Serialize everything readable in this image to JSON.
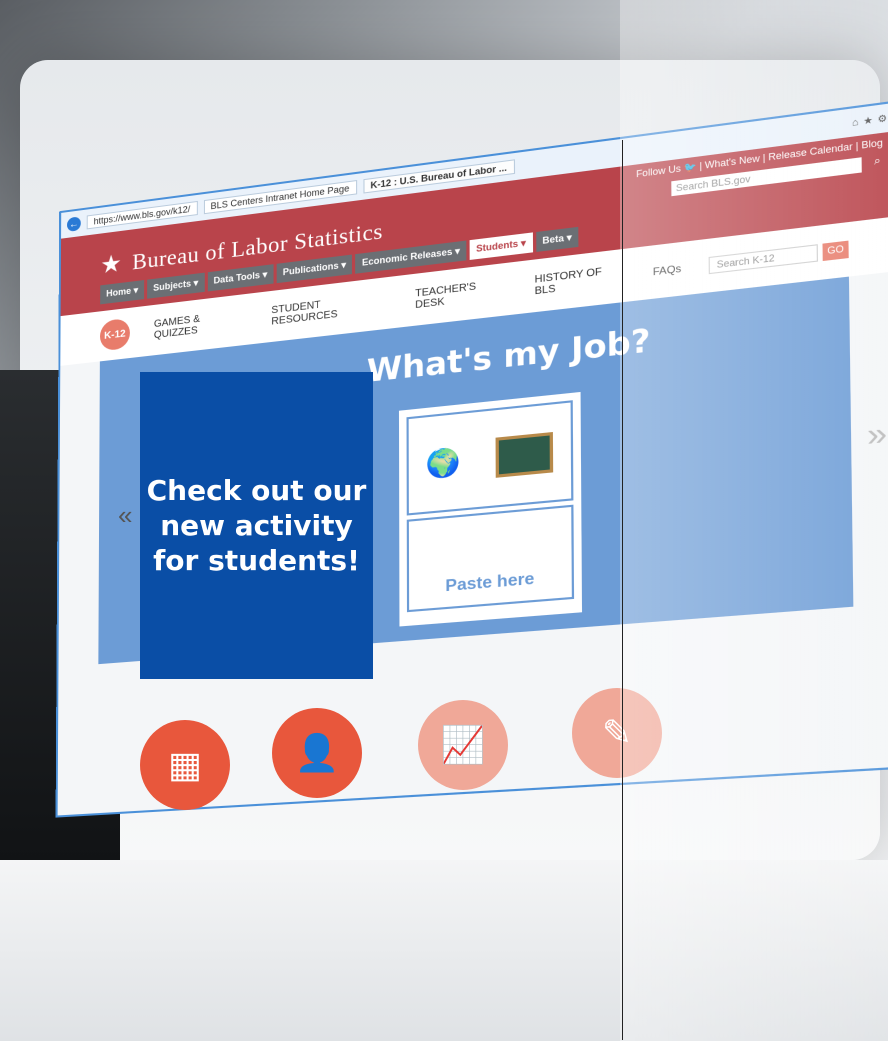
{
  "browser": {
    "url": "https://www.bls.gov/k12/",
    "tabs": [
      "BLS Centers Intranet Home Page",
      "K-12 : U.S. Bureau of Labor ..."
    ],
    "back_arrow": "←"
  },
  "header": {
    "follow_us": "Follow Us",
    "links": "| What's New | Release Calendar | Blog",
    "search_placeholder": "Search BLS.gov",
    "logo_text": "Bureau of Labor Statistics",
    "nav": [
      "Home ▾",
      "Subjects ▾",
      "Data Tools ▾",
      "Publications ▾",
      "Economic Releases ▾",
      "Students ▾",
      "Beta ▾"
    ]
  },
  "k12nav": {
    "badge": "K-12",
    "items": [
      "GAMES & QUIZZES",
      "STUDENT RESOURCES",
      "TEACHER'S DESK",
      "HISTORY OF BLS",
      "FAQs"
    ],
    "search_placeholder": "Search K-12",
    "go": "GO"
  },
  "hero": {
    "title": "What's my Job?",
    "paste_here": "Paste here",
    "next_arrow": "»",
    "prev_arrow": "«"
  },
  "callout": {
    "text": "Check out our new activity for students!"
  },
  "colors": {
    "header_red": "#b9444b",
    "callout_blue": "#0a4ea6",
    "hero_blue": "#6c9cd6",
    "icon_orange": "#e8573c"
  },
  "icons": [
    "crossword-icon",
    "reader-icon",
    "teacher-icon",
    "certificate-icon"
  ]
}
